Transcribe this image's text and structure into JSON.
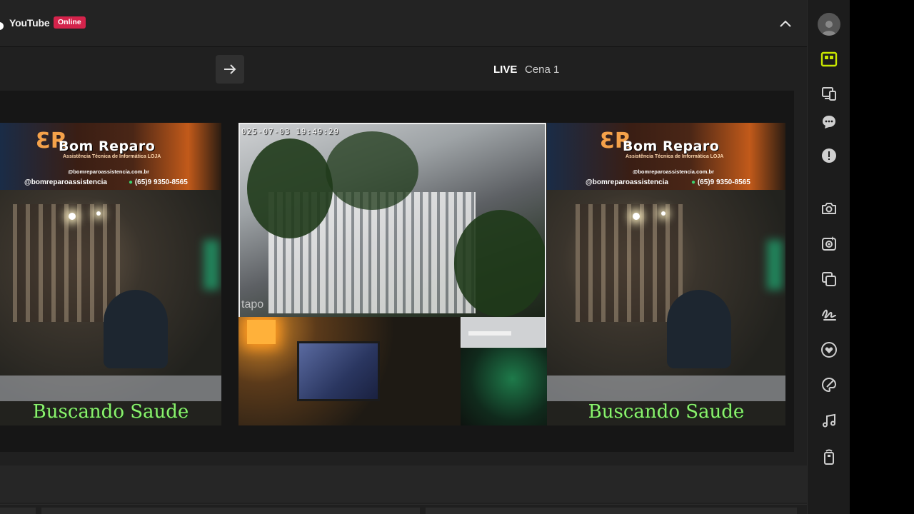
{
  "header": {
    "platform": "YouTube",
    "status_badge": "Online"
  },
  "toolbar": {
    "live_label": "LIVE",
    "scene_name": "Cena 1"
  },
  "preview": {
    "left_panel": {
      "brand_name": "Bom Reparo",
      "brand_sub": "Assistência Técnica de Informática LOJA",
      "website": "@bomreparoassistencia.com.br",
      "instagram": "@bomreparoassistencia",
      "phone": "(65)9 9350-8565",
      "caption": "Buscando Saude"
    },
    "center_panel": {
      "timestamp": "025-07-03 19:49:29",
      "camera_brand": "tapo"
    },
    "right_panel": {
      "brand_name": "Bom Reparo",
      "brand_sub": "Assistência Técnica de Informática LOJA",
      "website": "@bomreparoassistencia.com.br",
      "instagram": "@bomreparoassistencia",
      "phone": "(65)9 9350-8565",
      "caption": "Buscando Saude"
    }
  },
  "sidebar": {
    "active_color": "#c8e600",
    "icon_color": "#cfcfcf",
    "items": [
      {
        "icon": "avatar"
      },
      {
        "icon": "dashboard-icon",
        "active": true
      },
      {
        "icon": "devices-icon"
      },
      {
        "icon": "chat-icon"
      },
      {
        "icon": "alert-icon"
      },
      {
        "icon": "camera-icon"
      },
      {
        "icon": "record-icon"
      },
      {
        "icon": "layers-icon"
      },
      {
        "icon": "signature-icon"
      },
      {
        "icon": "heart-icon"
      },
      {
        "icon": "palette-icon"
      },
      {
        "icon": "music-icon"
      },
      {
        "icon": "remote-icon"
      }
    ]
  }
}
